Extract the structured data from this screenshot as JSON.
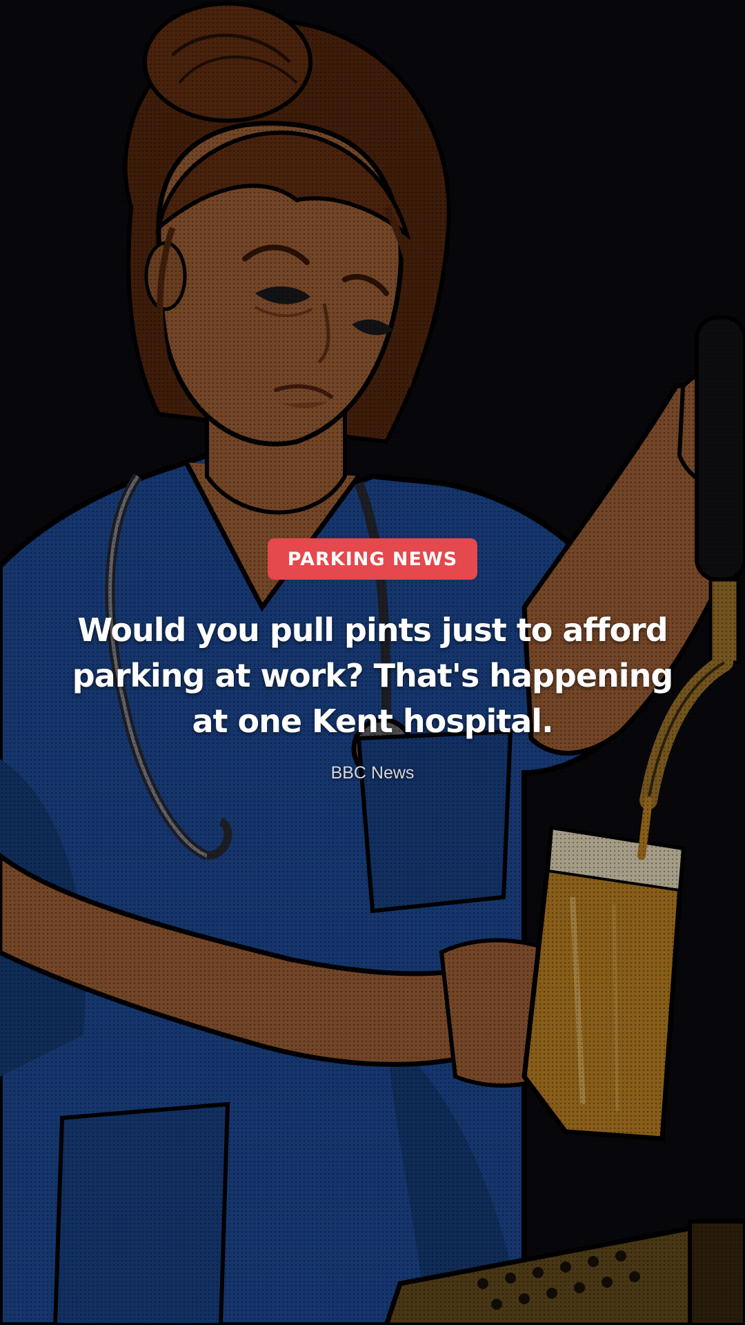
{
  "story": {
    "category_badge": "PARKING NEWS",
    "headline": "Would you pull pints just to afford parking at work? That's happening at one Kent hospital.",
    "source": "BBC News"
  },
  "background": {
    "image_subject": "illustration-nurse-pulling-pint-at-beer-tap",
    "colors": {
      "background": "#0b0a10",
      "scrubs": "#1f4fa0",
      "hair": "#6b3312",
      "skin": "#a9663a",
      "beer": "#c88a25",
      "brass": "#a87b2c"
    }
  },
  "theme": {
    "badge_color": "#e5484d",
    "text_color": "#ffffff",
    "source_color": "#d6d6de"
  }
}
